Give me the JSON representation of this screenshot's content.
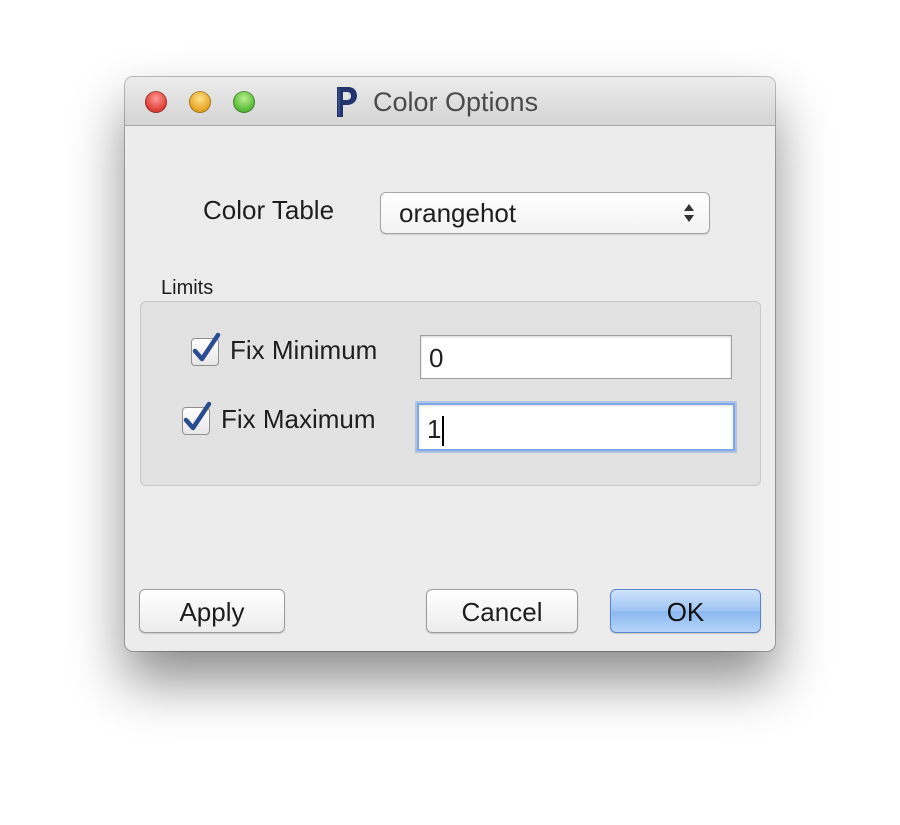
{
  "window": {
    "title": "Color Options",
    "app_icon": "p-logo-icon"
  },
  "color_table": {
    "label": "Color Table",
    "selected": "orangehot"
  },
  "limits": {
    "label": "Limits",
    "fix_minimum": {
      "label": "Fix Minimum",
      "checked": true,
      "value": "0"
    },
    "fix_maximum": {
      "label": "Fix Maximum",
      "checked": true,
      "value": "1"
    }
  },
  "buttons": {
    "apply": "Apply",
    "cancel": "Cancel",
    "ok": "OK"
  },
  "colors": {
    "checkmark": "#2a4d8f",
    "default_button": "#9ec4f3",
    "focus_ring": "#7fa9e8"
  }
}
